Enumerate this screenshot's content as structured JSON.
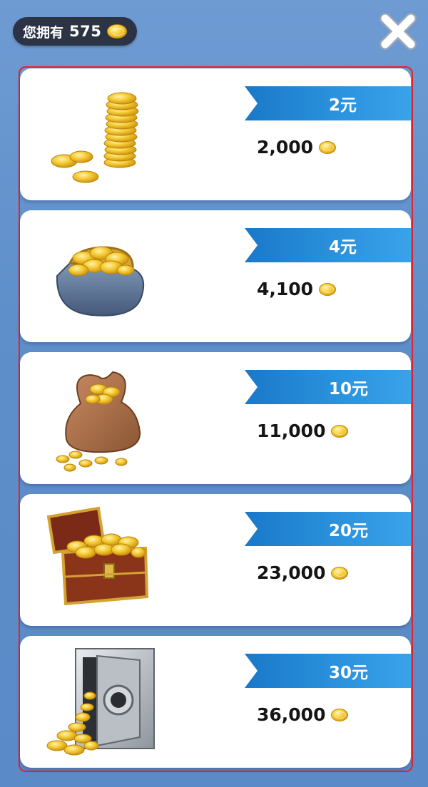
{
  "balance": {
    "label": "您拥有",
    "amount": "575",
    "icon": "coin-icon"
  },
  "close_button": {
    "icon": "close-x-icon"
  },
  "colors": {
    "background": "#5f8fca",
    "ribbon": "#2c94df",
    "frame": "#e0242f",
    "balance_bg": "#2b3344"
  },
  "packages": [
    {
      "price": "2元",
      "coins": "2,000",
      "icon": "coin-stack-icon"
    },
    {
      "price": "4元",
      "coins": "4,100",
      "icon": "coin-purse-icon"
    },
    {
      "price": "10元",
      "coins": "11,000",
      "icon": "coin-sack-icon"
    },
    {
      "price": "20元",
      "coins": "23,000",
      "icon": "treasure-chest-icon"
    },
    {
      "price": "30元",
      "coins": "36,000",
      "icon": "safe-vault-icon"
    }
  ]
}
